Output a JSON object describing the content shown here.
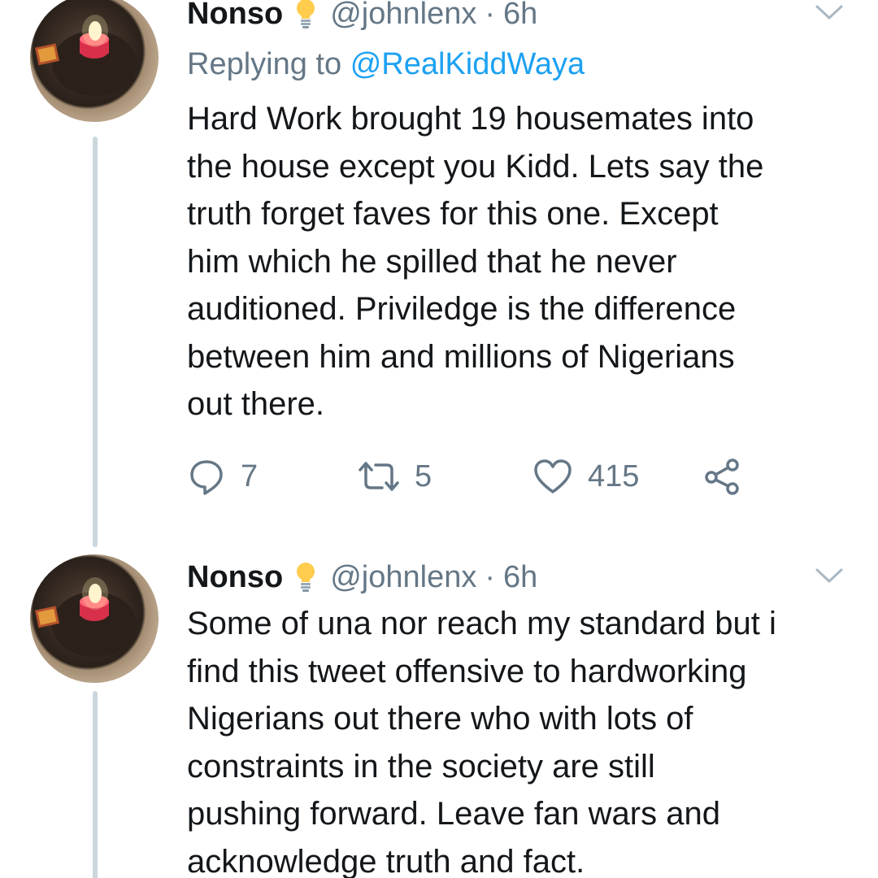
{
  "tweets": [
    {
      "author_name": "Nonso",
      "handle": "@johnlenx",
      "separator": "·",
      "time": "6h",
      "replying_prefix": "Replying to",
      "replying_to": "@RealKiddWaya",
      "body_lines": [
        "Hard Work brought 19 housemates into",
        "the house except you Kidd. Lets say the",
        "truth forget faves for this one. Except",
        "him which he spilled that he never",
        "auditioned. Priviledge is the difference",
        "between him and millions of Nigerians",
        "out there."
      ],
      "reply_count": "7",
      "retweet_count": "5",
      "like_count": "415"
    },
    {
      "author_name": "Nonso",
      "handle": "@johnlenx",
      "separator": "·",
      "time": "6h",
      "body_lines": [
        "Some of una nor reach my standard but i",
        "find this tweet offensive to hardworking",
        "Nigerians out there who with lots of",
        "constraints in the society are still",
        "pushing forward. Leave fan wars and",
        "acknowledge truth and fact."
      ]
    }
  ],
  "colors": {
    "text": "#14171a",
    "secondary": "#657786",
    "link": "#1da1f2",
    "thread_line": "#ccd6dd",
    "bulb": "#ffcc4d"
  },
  "icons": {
    "verified_emoji": "light-bulb-icon",
    "menu": "chevron-down-icon",
    "reply": "reply-bubble-icon",
    "retweet": "retweet-icon",
    "like": "heart-icon",
    "share": "share-icon"
  }
}
